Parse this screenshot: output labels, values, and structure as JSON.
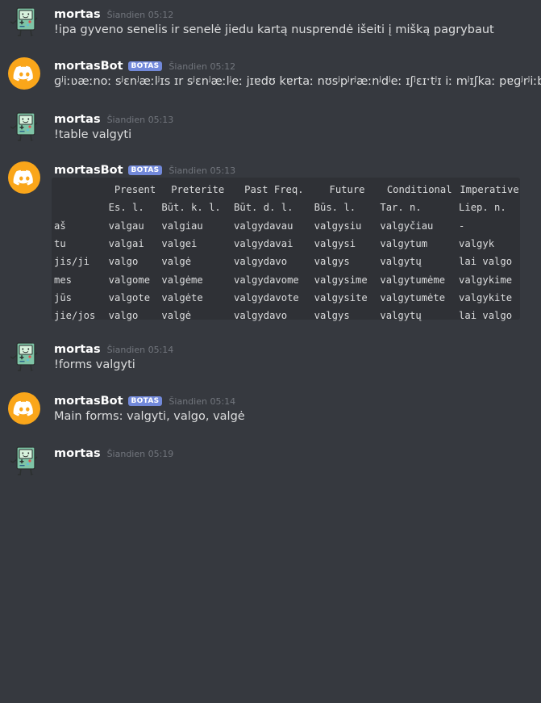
{
  "messages": [
    {
      "author": "mortas",
      "is_bot": false,
      "time": "Šiandien 05:12",
      "text": "!ipa gyveno senelis ir senelė jiedu kartą nusprendė išeiti į mišką pagrybaut"
    },
    {
      "author": "mortasBot",
      "is_bot": true,
      "badge": "BOTAS",
      "time": "Šiandien 05:12",
      "text": "ɡʲiːʋæːnoː sʲɛnʲæːlʲɪs ɪr sʲɛnʲæːlʲeː jɪɐdʊ kɐrtaː nʊsʲpʲrʲæːnʲdʲeː ɪʃʲɛɪˑtʲɪ iː mʲɪʃkaː pɐɡʲrʲiːbaˑʊt"
    },
    {
      "author": "mortas",
      "is_bot": false,
      "time": "Šiandien 05:13",
      "text": "!table valgyti"
    },
    {
      "author": "mortasBot",
      "is_bot": true,
      "badge": "BOTAS",
      "time": "Šiandien 05:13",
      "table": {
        "header1": [
          "",
          "Present",
          "Preterite",
          "Past Freq.",
          "Future",
          "Conditional",
          "Imperative"
        ],
        "header2": [
          "",
          "Es. l.",
          "Būt. k. l.",
          "Būt. d. l.",
          "Būs. l.",
          "Tar. n.",
          "Liep. n."
        ],
        "rows": [
          [
            "aš",
            "valgau",
            "valgiau",
            "valgydavau",
            "valgysiu",
            "valgyčiau",
            "-"
          ],
          [
            "tu",
            "valgai",
            "valgei",
            "valgydavai",
            "valgysi",
            "valgytum",
            "valgyk"
          ],
          [
            "jis/ji",
            "valgo",
            "valgė",
            "valgydavo",
            "valgys",
            "valgytų",
            "lai valgo"
          ],
          [
            "mes",
            "valgome",
            "valgėme",
            "valgydavome",
            "valgysime",
            "valgytumėme",
            "valgykime"
          ],
          [
            "jūs",
            "valgote",
            "valgėte",
            "valgydavote",
            "valgysite",
            "valgytumėte",
            "valgykite"
          ],
          [
            "jie/jos",
            "valgo",
            "valgė",
            "valgydavo",
            "valgys",
            "valgytų",
            "lai valgo"
          ]
        ]
      }
    },
    {
      "author": "mortas",
      "is_bot": false,
      "time": "Šiandien 05:14",
      "text": "!forms valgyti"
    },
    {
      "author": "mortasBot",
      "is_bot": true,
      "badge": "BOTAS",
      "time": "Šiandien 05:14",
      "text": "Main forms: valgyti, valgo, valgė"
    },
    {
      "author": "mortas",
      "is_bot": false,
      "time": "Šiandien 05:19",
      "text": ""
    }
  ],
  "colors": {
    "background": "#36393f",
    "code_background": "#2f3136",
    "bot_badge": "#7289da",
    "bot_avatar": "#faa61a",
    "robot_avatar": "#7ec4a6"
  },
  "icons": {
    "user_avatar": "bmo-robot-icon",
    "bot_avatar": "discord-logo-icon"
  }
}
